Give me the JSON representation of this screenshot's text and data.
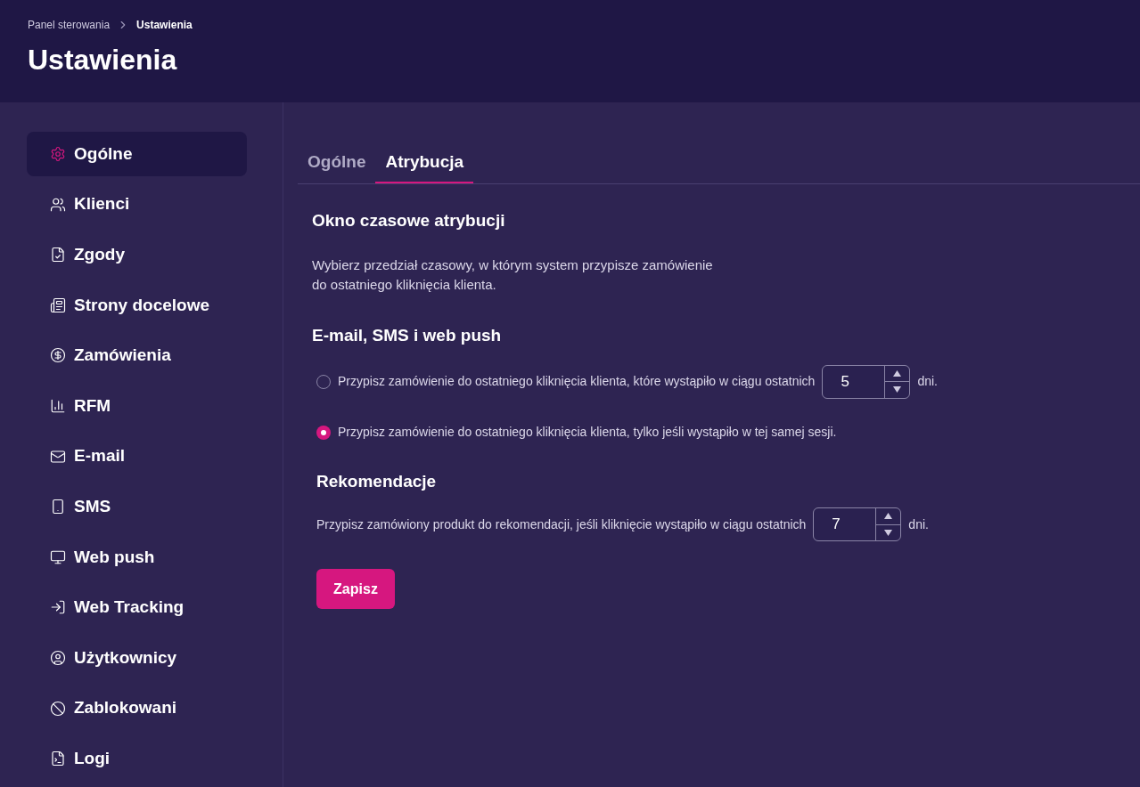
{
  "breadcrumb": [
    {
      "label": "Panel sterowania",
      "current": false
    },
    {
      "label": "Ustawienia",
      "current": true
    }
  ],
  "title": "Ustawienia",
  "sidebar": {
    "items": [
      {
        "label": "Ogólne",
        "selected": true
      },
      {
        "label": "Klienci",
        "selected": false
      },
      {
        "label": "Zgody",
        "selected": false
      },
      {
        "label": "Strony docelowe",
        "selected": false
      },
      {
        "label": "Zamówienia",
        "selected": false
      },
      {
        "label": "RFM",
        "selected": false
      },
      {
        "label": "E-mail",
        "selected": false
      },
      {
        "label": "SMS",
        "selected": false
      },
      {
        "label": "Web push",
        "selected": false
      },
      {
        "label": "Web Tracking",
        "selected": false
      },
      {
        "label": "Użytkownicy",
        "selected": false
      },
      {
        "label": "Zablokowani",
        "selected": false
      },
      {
        "label": "Logi",
        "selected": false
      }
    ]
  },
  "tabs": [
    {
      "label": "Ogólne",
      "selected": false
    },
    {
      "label": "Atrybucja",
      "selected": true
    }
  ],
  "attribution_window": {
    "heading": "Okno czasowe atrybucji",
    "description": "Wybierz przedział czasowy, w którym system przypisze zamówienie\ndo ostatniego kliknięcia klienta."
  },
  "channels": {
    "heading": "E-mail, SMS i web push",
    "options": [
      {
        "kind": "number",
        "label": "Przypisz zamówienie do ostatniego kliknięcia klienta, które wystąpiło w ciągu ostatnich",
        "value": "5",
        "suffix": "dni.",
        "selected": false
      },
      {
        "kind": "plain",
        "label": "Przypisz zamówienie do ostatniego kliknięcia klienta, tylko jeśli wystąpiło w tej samej sesji.",
        "selected": true
      }
    ]
  },
  "recommendations": {
    "heading": "Rekomendacje",
    "label": "Przypisz zamówiony produkt do rekomendacji, jeśli kliknięcie wystąpiło w ciągu ostatnich",
    "value": "7",
    "suffix": "dni."
  },
  "save_button": "Zapisz"
}
